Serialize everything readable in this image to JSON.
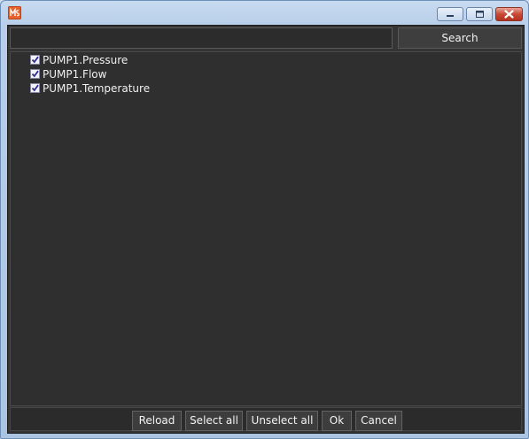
{
  "window": {
    "icon": "app-logo-icon",
    "controls": {
      "minimize_icon": "minimize-icon",
      "maximize_icon": "maximize-icon",
      "close_icon": "close-icon"
    }
  },
  "search": {
    "value": "",
    "placeholder": "",
    "button_label": "Search"
  },
  "tree": {
    "items": [
      {
        "label": "PUMP1.Pressure",
        "checked": true
      },
      {
        "label": "PUMP1.Flow",
        "checked": true
      },
      {
        "label": "PUMP1.Temperature",
        "checked": true
      }
    ]
  },
  "footer": {
    "reload_label": "Reload",
    "select_all_label": "Select all",
    "unselect_all_label": "Unselect all",
    "ok_label": "Ok",
    "cancel_label": "Cancel"
  },
  "colors": {
    "accent": "#e7622a",
    "panel_bg": "#2f2f2f",
    "text": "#f0f0f0"
  }
}
